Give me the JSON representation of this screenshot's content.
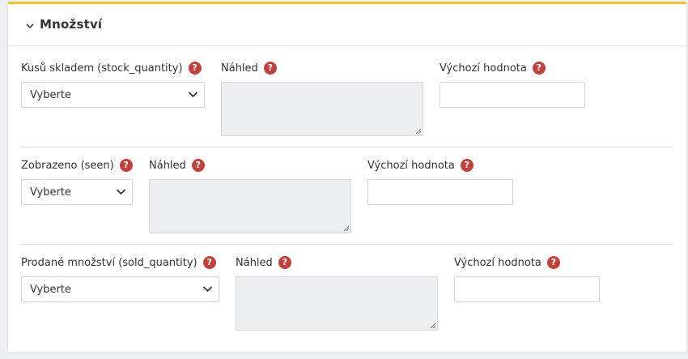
{
  "section": {
    "title": "Množství",
    "accent_color": "#f4c430"
  },
  "help_glyph": "?",
  "fields": [
    {
      "label": "Kusů skladem (stock_quantity)",
      "select_value": "Vyberte",
      "preview_label": "Náhled",
      "default_label": "Výchozí hodnota",
      "default_value": ""
    },
    {
      "label": "Zobrazeno (seen)",
      "select_value": "Vyberte",
      "preview_label": "Náhled",
      "default_label": "Výchozí hodnota",
      "default_value": ""
    },
    {
      "label": "Prodané množství (sold_quantity)",
      "select_value": "Vyberte",
      "preview_label": "Náhled",
      "default_label": "Výchozí hodnota",
      "default_value": ""
    }
  ],
  "icons": {
    "collapse": "chevron-down-icon",
    "help": "question-circle-icon",
    "select": "chevron-down-icon",
    "resize": "resize-grip-icon"
  }
}
